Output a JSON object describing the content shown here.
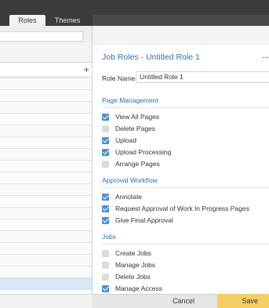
{
  "tabs": [
    {
      "label": "Roles"
    },
    {
      "label": "Themes"
    }
  ],
  "header": {
    "title": "Job Roles - Untitled Role 1",
    "more_label": "..."
  },
  "role_name": {
    "label": "Role Name",
    "value": "Untitled Role 1"
  },
  "add_label": "+",
  "sections": [
    {
      "title": "Page Management",
      "permissions": [
        {
          "label": "View All Pages",
          "checked": true
        },
        {
          "label": "Delete Pages",
          "checked": false
        },
        {
          "label": "Upload",
          "checked": true
        },
        {
          "label": "Upload Processing",
          "checked": true
        },
        {
          "label": "Arrange Pages",
          "checked": false
        }
      ]
    },
    {
      "title": "Approval Workflow",
      "permissions": [
        {
          "label": "Annotate",
          "checked": true
        },
        {
          "label": "Request Approval of Work In Progress Pages",
          "checked": true
        },
        {
          "label": "Give Final Approval",
          "checked": true
        }
      ]
    },
    {
      "title": "Jobs",
      "permissions": [
        {
          "label": "Create Jobs",
          "checked": false
        },
        {
          "label": "Manage Jobs",
          "checked": false
        },
        {
          "label": "Delete Jobs",
          "checked": false
        },
        {
          "label": "Manage Access",
          "checked": true
        }
      ]
    }
  ],
  "footer": {
    "cancel_label": "Cancel",
    "save_label": "Save"
  },
  "colors": {
    "accent": "#2f6fb1",
    "checkbox_on": "#4a90d9",
    "save_button": "#f6cf63",
    "selected_row": "#d8e7f5"
  }
}
